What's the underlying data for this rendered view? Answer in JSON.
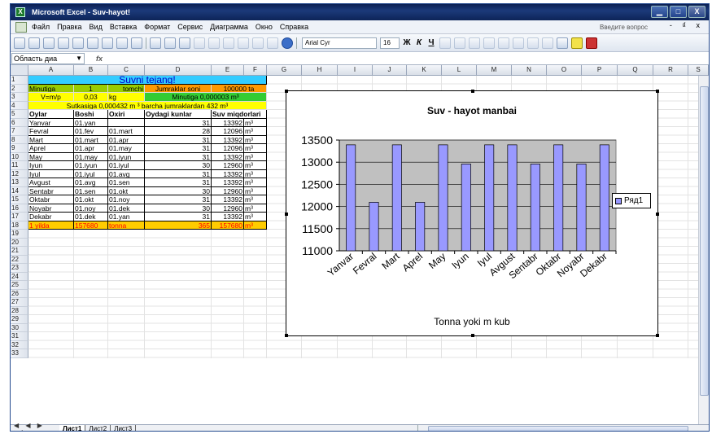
{
  "window": {
    "title": "Microsoft Excel - Suv-hayot!",
    "app_icon_text": "X",
    "min": "▁",
    "max": "□",
    "close": "X"
  },
  "menu": {
    "items": [
      "Файл",
      "Правка",
      "Вид",
      "Вставка",
      "Формат",
      "Сервис",
      "Диаграмма",
      "Окно",
      "Справка"
    ],
    "help_placeholder": "Введите вопрос",
    "doc_controls": "- ₫ x"
  },
  "toolbar": {
    "font": "Arial Cyr",
    "size": "16",
    "bold": "Ж",
    "italic": "К",
    "underline": "Ч"
  },
  "formula_bar": {
    "name_box": "Область диа",
    "fx": "fx"
  },
  "columns": [
    "A",
    "B",
    "C",
    "D",
    "E",
    "F",
    "G",
    "H",
    "I",
    "J",
    "K",
    "L",
    "M",
    "N",
    "O",
    "P",
    "Q",
    "R",
    "S"
  ],
  "sheet": {
    "title": "Suvni tejang!",
    "row2": {
      "a": "Minutiga",
      "b": "1",
      "c": "tomchi",
      "d": "Jumraklar  soni",
      "e": "100000 ta"
    },
    "row3": {
      "a": "V=m/p",
      "b": "0,03",
      "c": "kg",
      "d": "Minutiga 0,000003  m³"
    },
    "row4": {
      "text": "Sutkasiga 0,000432 m ³   barcha jumraklardan 432 m³"
    },
    "headers": [
      "Oylar",
      "Boshi",
      "Oxiri",
      "Oydagi kunlar",
      "Suv miqdorlari"
    ],
    "rows": [
      [
        "Yanvar",
        "01.yan",
        "",
        "31",
        "13392",
        "m³"
      ],
      [
        "Fevral",
        "01.fev",
        "01.mart",
        "28",
        "12096",
        "m³"
      ],
      [
        "Mart",
        "01.mart",
        "01.apr",
        "31",
        "13392",
        "m³"
      ],
      [
        "Aprel",
        "01.apr",
        "01.may",
        "31",
        "12096",
        "m³"
      ],
      [
        "May",
        "01.may",
        "01.iyun",
        "31",
        "13392",
        "m³"
      ],
      [
        "Iyun",
        "01.iyun",
        "01.iyul",
        "30",
        "12960",
        "m³"
      ],
      [
        "Iyul",
        "01.iyul",
        "01.avg",
        "31",
        "13392",
        "m³"
      ],
      [
        "Avgust",
        "01.avg",
        "01.sen",
        "31",
        "13392",
        "m³"
      ],
      [
        "Sentabr",
        "01.sen",
        "01.okt",
        "30",
        "12960",
        "m³"
      ],
      [
        "Oktabr",
        "01.okt",
        "01.noy",
        "31",
        "13392",
        "m³"
      ],
      [
        "Noyabr",
        "01.noy",
        "01.dek",
        "30",
        "12960",
        "m³"
      ],
      [
        "Dekabr",
        "01.dek",
        "01.yan",
        "31",
        "13392",
        "m³"
      ]
    ],
    "total": [
      "1 yilda",
      "157680",
      "tonna",
      "365",
      "157680",
      "m³"
    ]
  },
  "colors": {
    "title_bg": "#33ccff",
    "row2_bg": "#99cc00",
    "row2_orange": "#ff9900",
    "row3_bg": "#33cc33",
    "row4_bg": "#ffff00",
    "total_bg": "#ffcc00",
    "total_text": "#ff0000",
    "bar_fill": "#9999ff",
    "plot_bg": "#c0c0c0"
  },
  "chart_data": {
    "type": "bar",
    "title": "Suv - hayot manbai",
    "xlabel": "Tonna yoki m kub",
    "ylabel": "",
    "ylim": [
      11000,
      13500
    ],
    "yticks": [
      11000,
      11500,
      12000,
      12500,
      13000,
      13500
    ],
    "categories": [
      "Yanvar",
      "Fevral",
      "Mart",
      "Aprel",
      "May",
      "Iyun",
      "Iyul",
      "Avgust",
      "Sentabr",
      "Oktabr",
      "Noyabr",
      "Dekabr"
    ],
    "series": [
      {
        "name": "Ряд1",
        "values": [
          13392,
          12096,
          13392,
          12096,
          13392,
          12960,
          13392,
          13392,
          12960,
          13392,
          12960,
          13392
        ]
      }
    ],
    "legend": "right"
  },
  "tabs": {
    "nav": "◀ ◀ ▶ ▶|",
    "sheets": [
      "Лист1",
      "Лист2",
      "Лист3"
    ]
  },
  "scroll": {
    "ellipsis": "III"
  }
}
